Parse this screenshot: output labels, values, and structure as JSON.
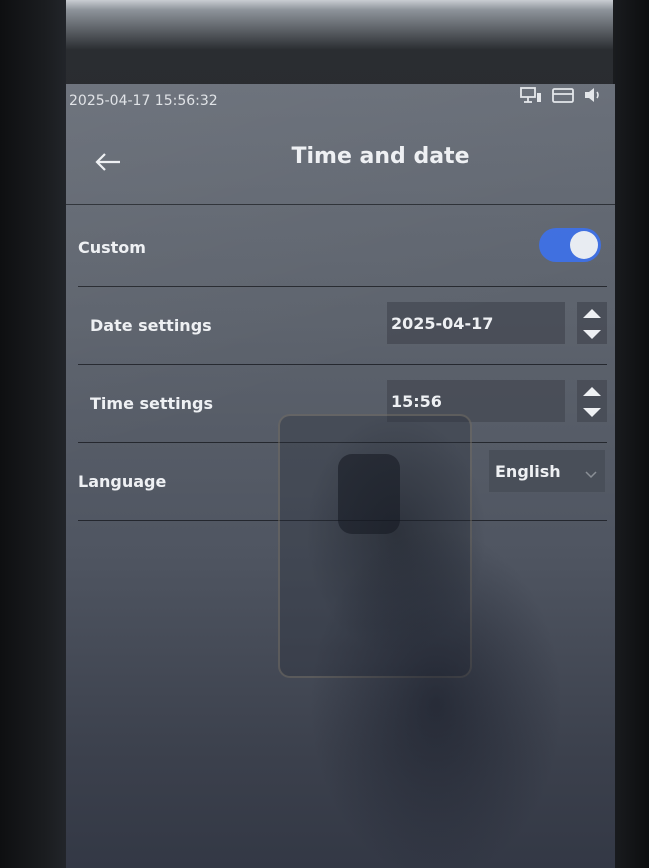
{
  "status_bar": {
    "datetime": "2025-04-17 15:56:32",
    "icons": [
      "network-icon",
      "card-icon",
      "speaker-icon"
    ]
  },
  "header": {
    "title": "Time and date",
    "back_icon": "arrow-left-icon"
  },
  "settings": {
    "custom": {
      "label": "Custom",
      "toggle_on": true
    },
    "date": {
      "label": "Date settings",
      "value": "2025-04-17"
    },
    "time": {
      "label": "Time settings",
      "value": "15:56"
    },
    "language": {
      "label": "Language",
      "value": "English"
    }
  },
  "colors": {
    "toggle_active": "#3f6fe0",
    "screen_bg": "#5d636d",
    "text": "#eef0f3"
  }
}
